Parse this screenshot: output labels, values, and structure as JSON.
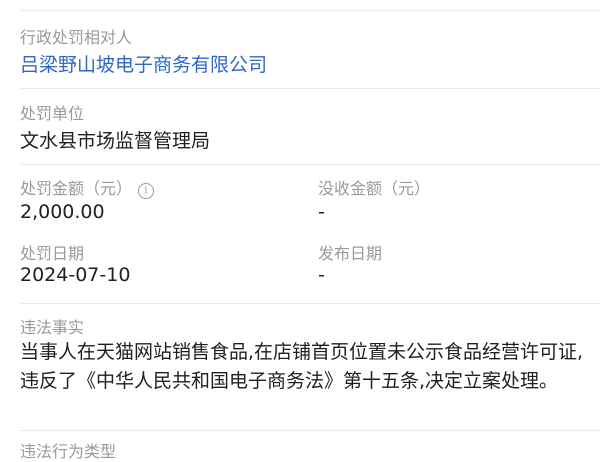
{
  "party": {
    "label": "行政处罚相对人",
    "value": "吕梁野山坡电子商务有限公司"
  },
  "unit": {
    "label": "处罚单位",
    "value": "文水县市场监督管理局"
  },
  "amount": {
    "label": "处罚金额（元）",
    "value": "2,000.00",
    "info_icon": "info-icon"
  },
  "confiscation": {
    "label": "没收金额（元）",
    "value": "-"
  },
  "date": {
    "label": "处罚日期",
    "value": "2024-07-10"
  },
  "publish": {
    "label": "发布日期",
    "value": "-"
  },
  "facts": {
    "label": "违法事实",
    "text": "当事人在天猫网站销售食品,在店铺首页位置未公示食品经营许可证,违反了《中华人民共和国电子商务法》第十五条,决定立案处理。"
  },
  "next_section": {
    "label": "违法行为类型"
  },
  "colors": {
    "link": "#2f67c8",
    "label": "#9a9a9a",
    "divider": "#e9e9e9"
  }
}
